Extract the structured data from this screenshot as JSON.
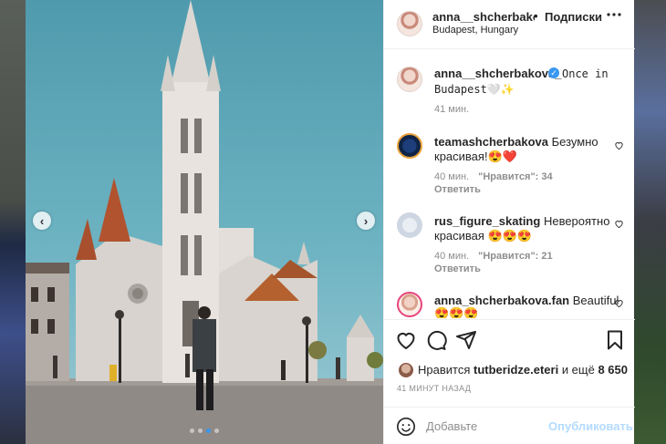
{
  "post": {
    "author": "anna__shcherbakova_",
    "follow_label": "Подписки",
    "separator": "•",
    "location": "Budapest, Hungary",
    "more_icon": "ellipsis-icon"
  },
  "caption": {
    "author": "anna__shcherbakova_",
    "text": "Once in Budapest🤍✨",
    "time": "41 мин."
  },
  "comments": [
    {
      "author": "teamashcherbakova",
      "text_line1": "Безумно",
      "text_line2": "красивая!😍❤️",
      "time": "40 мин.",
      "likes": "\"Нравится\": 34",
      "reply": "Ответить"
    },
    {
      "author": "rus_figure_skating",
      "text_line1": "Невероятно",
      "text_line2": "красивая 😍😍😍",
      "time": "40 мин.",
      "likes": "\"Нравится\": 21",
      "reply": "Ответить"
    },
    {
      "author": "anna_shcherbakova.fan",
      "text_line1": "Beautiful",
      "text_line2": "😍😍😍"
    }
  ],
  "liked_by": {
    "prefix": "Нравится",
    "user": "tutberidze.eteri",
    "connector": "и ещё",
    "count": "8 650"
  },
  "posted_time": "41 МИНУТ НАЗАД",
  "comment_box": {
    "placeholder": "Добавьте",
    "publish_label": "Опубликовать"
  },
  "carousel": {
    "prev_symbol": "‹",
    "next_symbol": "›",
    "active_index": 2,
    "count": 4
  },
  "colors": {
    "accent": "#3897f0",
    "publish_disabled": "#b3dbff",
    "secondary_text": "#8e8e8e",
    "heart_red": "#ed4956"
  }
}
